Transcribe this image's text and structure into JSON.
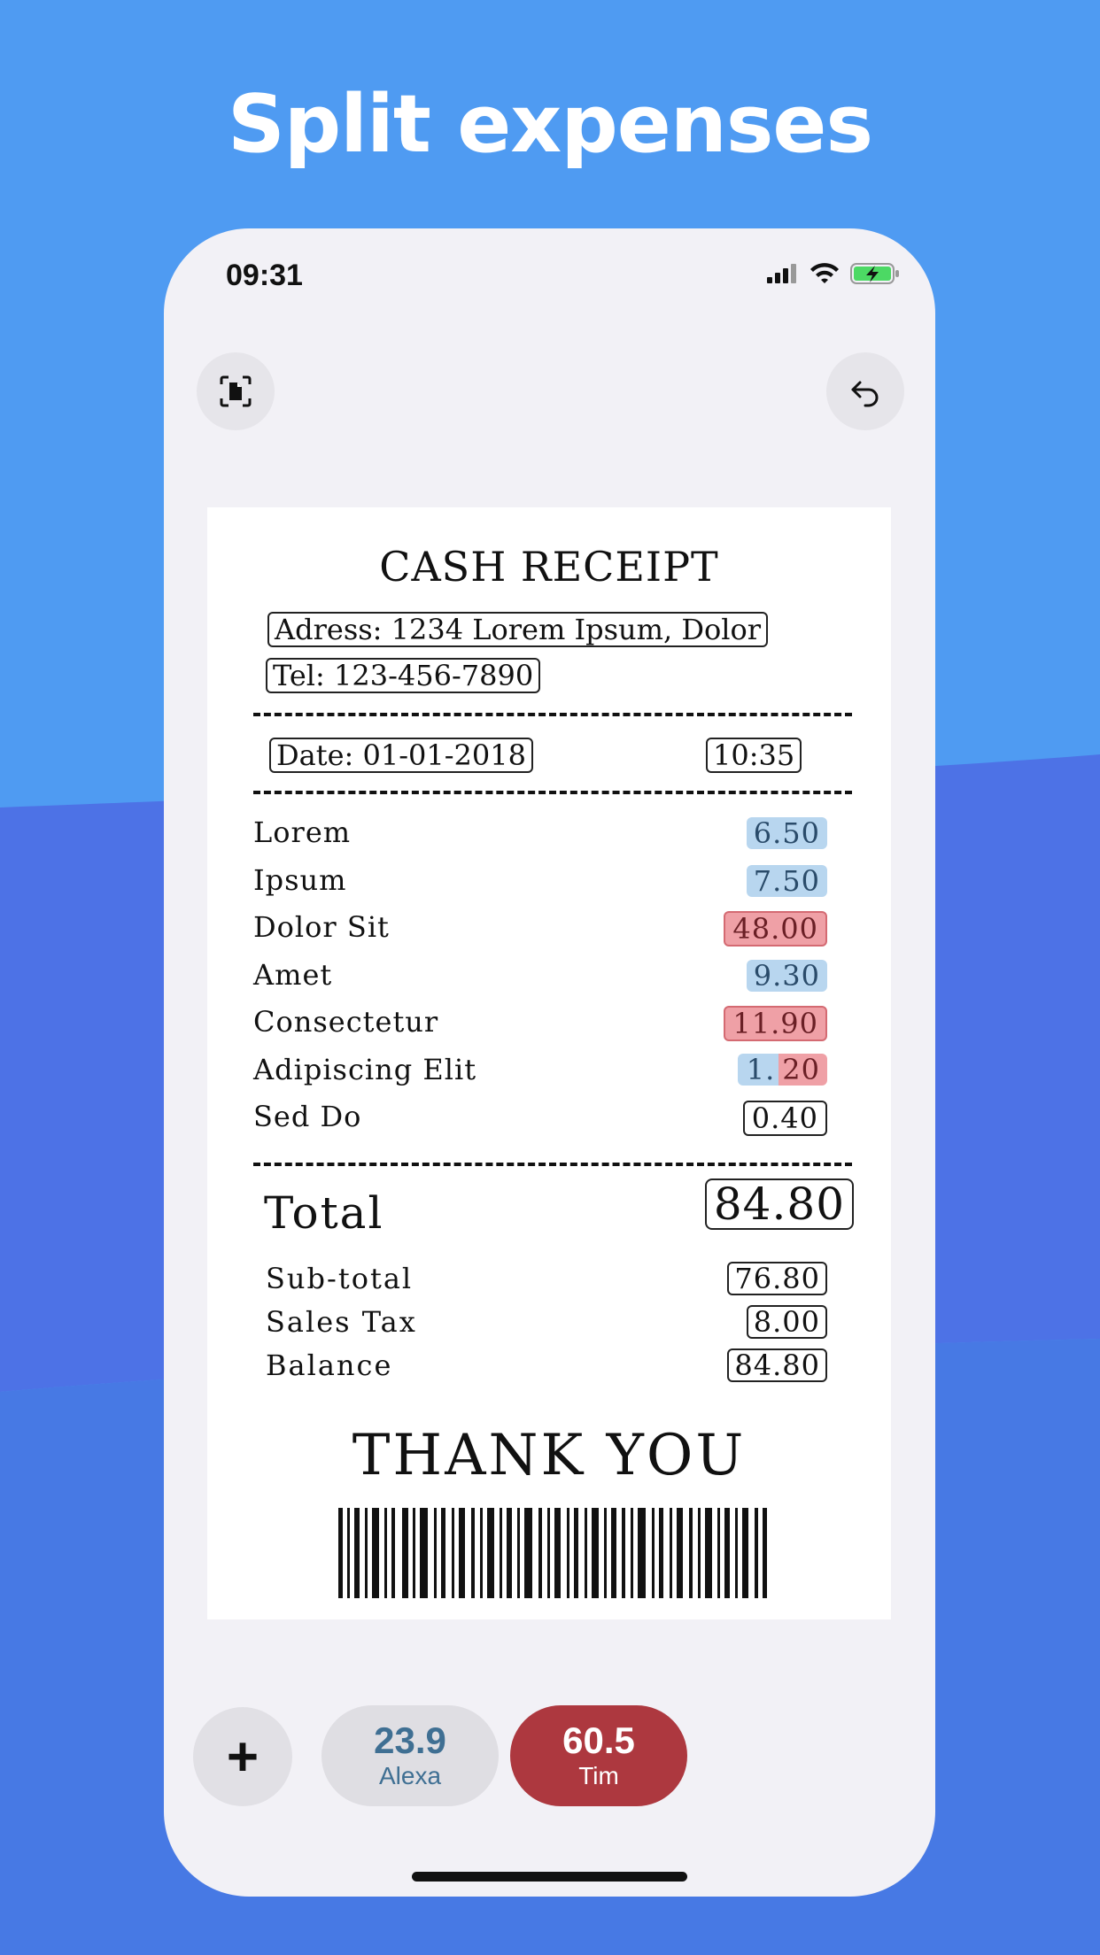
{
  "headline": "Split expenses",
  "status_bar": {
    "time": "09:31"
  },
  "toolbar": {
    "scan_icon": "document-scan-icon",
    "undo_icon": "undo-icon"
  },
  "receipt": {
    "title": "CASH RECEIPT",
    "address": "Adress: 1234 Lorem Ipsum, Dolor",
    "tel": "Tel: 123-456-7890",
    "date": "Date: 01-01-2018",
    "time": "10:35",
    "items": [
      {
        "name": "Lorem",
        "price": "6.50",
        "assigned": "Alexa"
      },
      {
        "name": "Ipsum",
        "price": "7.50",
        "assigned": "Alexa"
      },
      {
        "name": "Dolor Sit",
        "price": "48.00",
        "assigned": "Tim"
      },
      {
        "name": "Amet",
        "price": "9.30",
        "assigned": "Alexa"
      },
      {
        "name": "Consectetur",
        "price": "11.90",
        "assigned": "Tim"
      },
      {
        "name": "Adipiscing Elit",
        "price": "1.20",
        "price_part_a": "1.",
        "price_part_b": "20",
        "assigned": "split"
      },
      {
        "name": "Sed Do",
        "price": "0.40",
        "assigned": "none"
      }
    ],
    "total_label": "Total",
    "total_value": "84.80",
    "subtotal_label": "Sub-total",
    "subtotal_value": "76.80",
    "tax_label": "Sales Tax",
    "tax_value": "8.00",
    "balance_label": "Balance",
    "balance_value": "84.80",
    "thanks": "THANK YOU"
  },
  "split_bar": {
    "add_label": "+",
    "people": [
      {
        "name": "Alexa",
        "amount": "23.9",
        "color": "#3f6f93"
      },
      {
        "name": "Tim",
        "amount": "60.5",
        "color": "#ad383f"
      }
    ]
  },
  "colors": {
    "background": "#4f9bf2",
    "alexa": "#b8d6ef",
    "tim": "#efa0a6"
  }
}
